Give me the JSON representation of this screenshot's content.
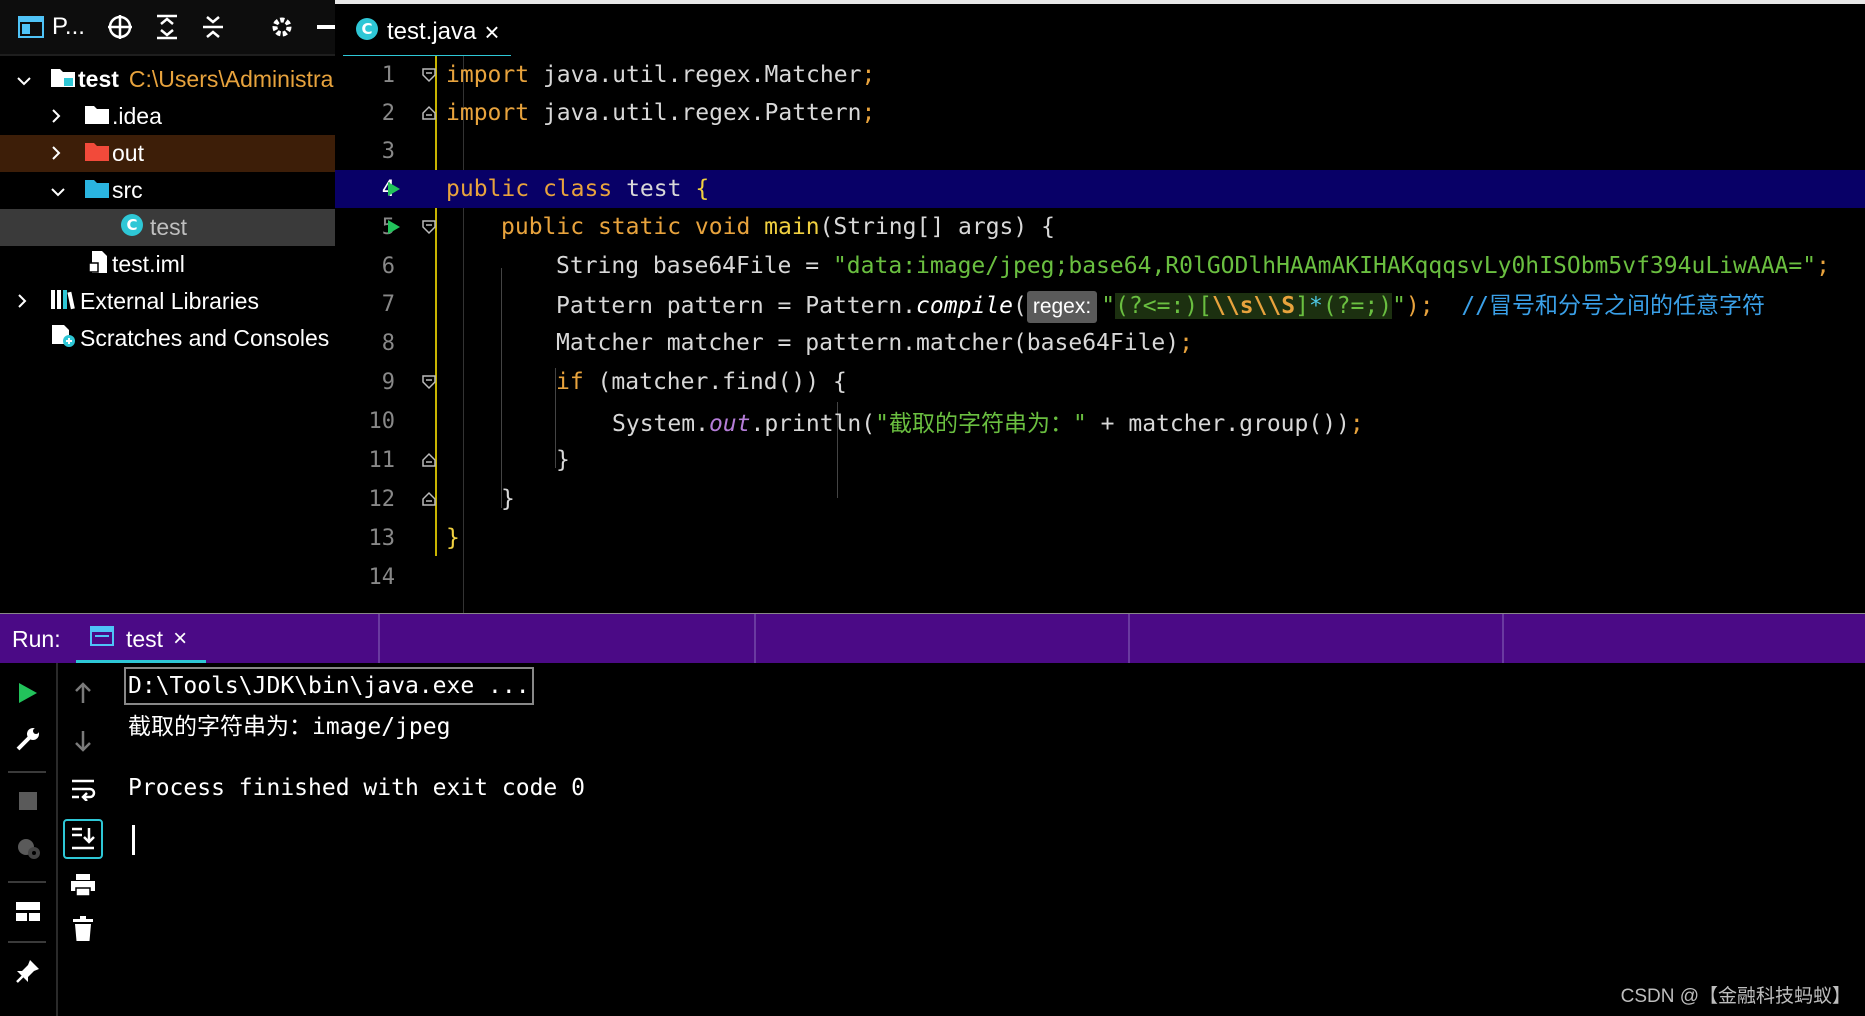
{
  "project_toolbar": {
    "title": "P...",
    "icons": [
      "project-icon",
      "locate-icon",
      "expand-all-icon",
      "collapse-all-icon",
      "gear-icon",
      "minimize-icon"
    ]
  },
  "project_tree": {
    "items": [
      {
        "name": "test",
        "path": "C:\\Users\\Administra",
        "expanded": true,
        "icon": "module-folder-icon"
      },
      {
        "name": ".idea",
        "expanded": false,
        "icon": "folder-icon"
      },
      {
        "name": "out",
        "expanded": false,
        "icon": "excluded-folder-icon",
        "color": "#f24a3a"
      },
      {
        "name": "src",
        "expanded": true,
        "icon": "source-folder-icon",
        "color": "#2ab4e0"
      },
      {
        "name": "test",
        "icon": "java-class-icon"
      },
      {
        "name": "test.iml",
        "icon": "iml-file-icon"
      },
      {
        "name": "External Libraries",
        "expanded": false,
        "icon": "libraries-icon"
      },
      {
        "name": "Scratches and Consoles",
        "icon": "scratches-icon"
      }
    ]
  },
  "editor_tab": {
    "label": "test.java",
    "close": "×"
  },
  "editor": {
    "line_numbers": [
      "1",
      "2",
      "3",
      "4",
      "5",
      "6",
      "7",
      "8",
      "9",
      "10",
      "11",
      "12",
      "13",
      "14"
    ],
    "lines": {
      "l1": {
        "kw": "import",
        "rest": " java.util.regex.Matcher",
        "semi": ";"
      },
      "l2": {
        "kw": "import",
        "rest": " java.util.regex.Pattern",
        "semi": ";"
      },
      "l4": {
        "kw1": "public",
        "kw2": "class",
        "name": "test",
        "brace": "{"
      },
      "l5": {
        "kw1": "public",
        "kw2": "static",
        "kw3": "void",
        "fn": "main",
        "rest": "(String[] args) {"
      },
      "l6": {
        "pre": "String base64File = ",
        "str": "\"data:image/jpeg;base64,R0lGODlhHAAmAKIHAKqqqsvLy0hISObm5vf394uLiwAAA=\"",
        "semi": ";"
      },
      "l7": {
        "pre": "Pattern pattern = Pattern.",
        "fn": "compile",
        "open": "(",
        "hint": "regex:",
        "q1": "\"",
        "r1": "(?<=:)[",
        "r2": "\\\\s\\\\S",
        "r3": "]",
        "r4": "*",
        "r5": "(?=;)",
        "q2": "\"",
        "close": ");",
        "comment": "//冒号和分号之间的任意字符"
      },
      "l8": {
        "pre": "Matcher matcher = pattern.matcher(base64File)",
        "semi": ";"
      },
      "l9": {
        "kw": "if",
        "rest": " (matcher.find()) {"
      },
      "l10": {
        "pre": "System.",
        "st": "out",
        "mid": ".println(",
        "str": "\"截取的字符串为：\"",
        "rest": " + matcher.group())",
        "semi": ";"
      },
      "l11": {
        "text": "}"
      },
      "l12": {
        "text": "}"
      },
      "l13": {
        "text": "}"
      }
    }
  },
  "run_window": {
    "label": "Run:",
    "tab": "test",
    "tab_close": "×",
    "console": {
      "cmd": "D:\\Tools\\JDK\\bin\\java.exe ...",
      "output": "截取的字符串为：image/jpeg",
      "finish": "Process finished with exit code 0"
    }
  },
  "watermark": "CSDN @【金融科技蚂蚁】",
  "colors": {
    "keyword": "#e8a33d",
    "string": "#6abf40",
    "comment": "#3aa0e8",
    "highlight_line": "#080067",
    "run_header": "#4b0a86",
    "accent": "#2ec7d6"
  }
}
